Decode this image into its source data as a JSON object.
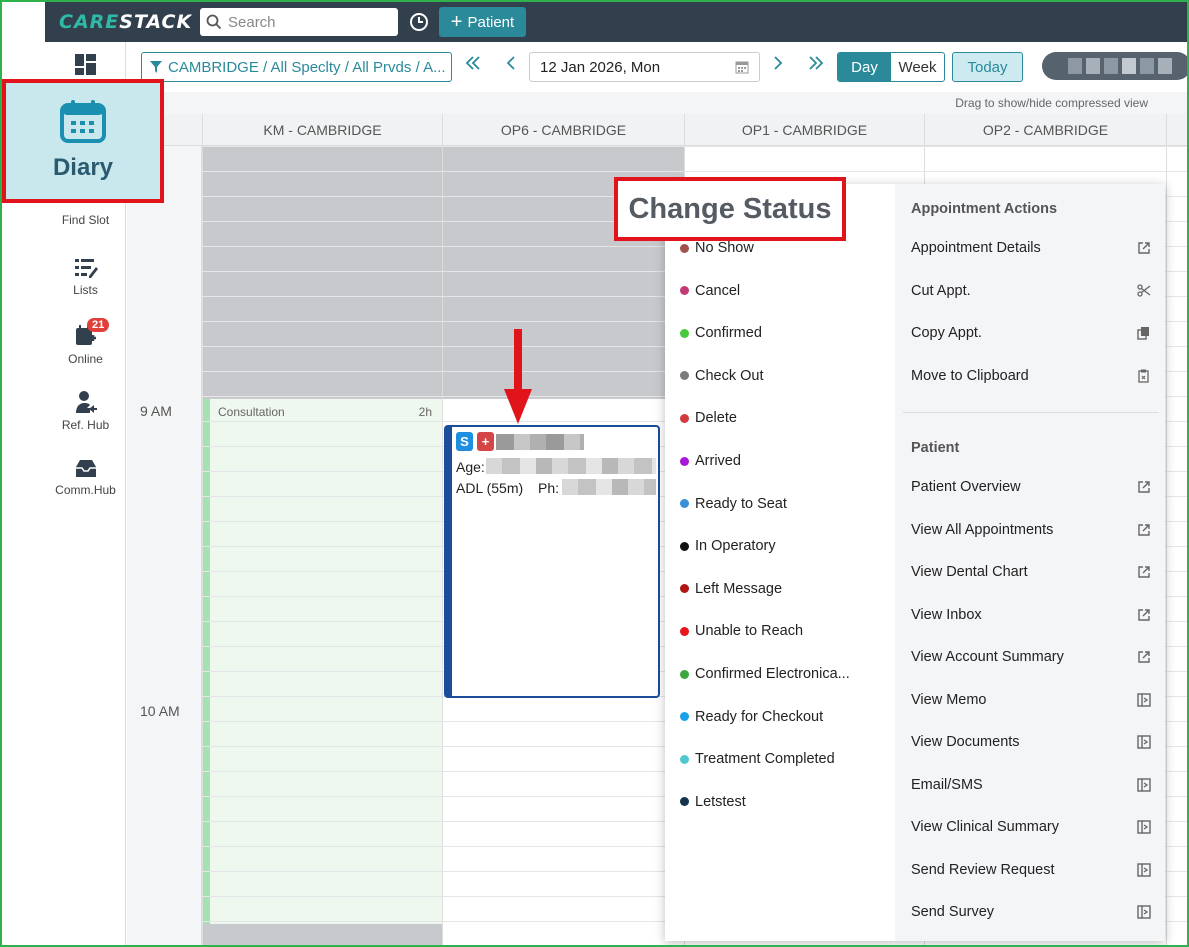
{
  "app": {
    "logo_a": "CARE",
    "logo_b": "STACK"
  },
  "topbar": {
    "search_placeholder": "Search",
    "add_patient": "Patient"
  },
  "nav": {
    "diary": "Diary",
    "items": [
      {
        "label": "Find Slot",
        "icon": "find-slot-icon"
      },
      {
        "label": "Lists",
        "icon": "lists-icon"
      },
      {
        "label": "Online",
        "icon": "online-icon",
        "badge": "21"
      },
      {
        "label": "Ref. Hub",
        "icon": "ref-hub-icon"
      },
      {
        "label": "Comm.Hub",
        "icon": "comm-hub-icon"
      }
    ]
  },
  "toolbar": {
    "filter": "CAMBRIDGE / All Speclty / All Prvds / A...",
    "date": "12 Jan 2026, Mon",
    "view_day": "Day",
    "view_week": "Week",
    "today": "Today"
  },
  "grid": {
    "hint": "Drag to show/hide compressed view",
    "columns": [
      "KM - CAMBRIDGE",
      "OP6 - CAMBRIDGE",
      "OP1 - CAMBRIDGE",
      "OP2 - CAMBRIDGE"
    ],
    "times": [
      "9 AM",
      "10 AM"
    ],
    "block": {
      "label": "Consultation",
      "duration": "2h"
    }
  },
  "appointment": {
    "tag_s": "S",
    "tag_plus": "+",
    "age_label": "Age:",
    "proc": "ADL (55m)",
    "phone_label": "Ph:"
  },
  "menu": {
    "title": "Change Status",
    "statuses": [
      {
        "label": "No Show",
        "color": "#a0524b"
      },
      {
        "label": "Cancel",
        "color": "#c23a73"
      },
      {
        "label": "Confirmed",
        "color": "#45c93d"
      },
      {
        "label": "Check Out",
        "color": "#7b7b7b"
      },
      {
        "label": "Delete",
        "color": "#d3393c"
      },
      {
        "label": "Arrived",
        "color": "#a818d6"
      },
      {
        "label": "Ready to Seat",
        "color": "#3a8fd8"
      },
      {
        "label": "In Operatory",
        "color": "#111111"
      },
      {
        "label": "Left Message",
        "color": "#b01414"
      },
      {
        "label": "Unable to Reach",
        "color": "#e8141c"
      },
      {
        "label": "Confirmed Electronica...",
        "color": "#3aa83a"
      },
      {
        "label": "Ready for Checkout",
        "color": "#1aa0e8"
      },
      {
        "label": "Treatment Completed",
        "color": "#4fc9cf"
      },
      {
        "label": "Letstest",
        "color": "#16324a"
      }
    ],
    "appointment_actions_title": "Appointment Actions",
    "appointment_actions": [
      {
        "label": "Appointment Details",
        "icon": "external-link-icon"
      },
      {
        "label": "Cut Appt.",
        "icon": "scissors-icon"
      },
      {
        "label": "Copy Appt.",
        "icon": "copy-icon"
      },
      {
        "label": "Move to Clipboard",
        "icon": "clipboard-icon"
      }
    ],
    "patient_title": "Patient",
    "patient_actions": [
      {
        "label": "Patient Overview",
        "icon": "external-link-icon"
      },
      {
        "label": "View All Appointments",
        "icon": "external-link-icon"
      },
      {
        "label": "View Dental Chart",
        "icon": "external-link-icon"
      },
      {
        "label": "View Inbox",
        "icon": "external-link-icon"
      },
      {
        "label": "View Account Summary",
        "icon": "external-link-icon"
      },
      {
        "label": "View Memo",
        "icon": "side-panel-icon"
      },
      {
        "label": "View Documents",
        "icon": "side-panel-icon"
      },
      {
        "label": "Email/SMS",
        "icon": "side-panel-icon"
      },
      {
        "label": "View Clinical Summary",
        "icon": "side-panel-icon"
      },
      {
        "label": "Send Review Request",
        "icon": "side-panel-icon"
      },
      {
        "label": "Send Survey",
        "icon": "side-panel-icon"
      }
    ]
  }
}
